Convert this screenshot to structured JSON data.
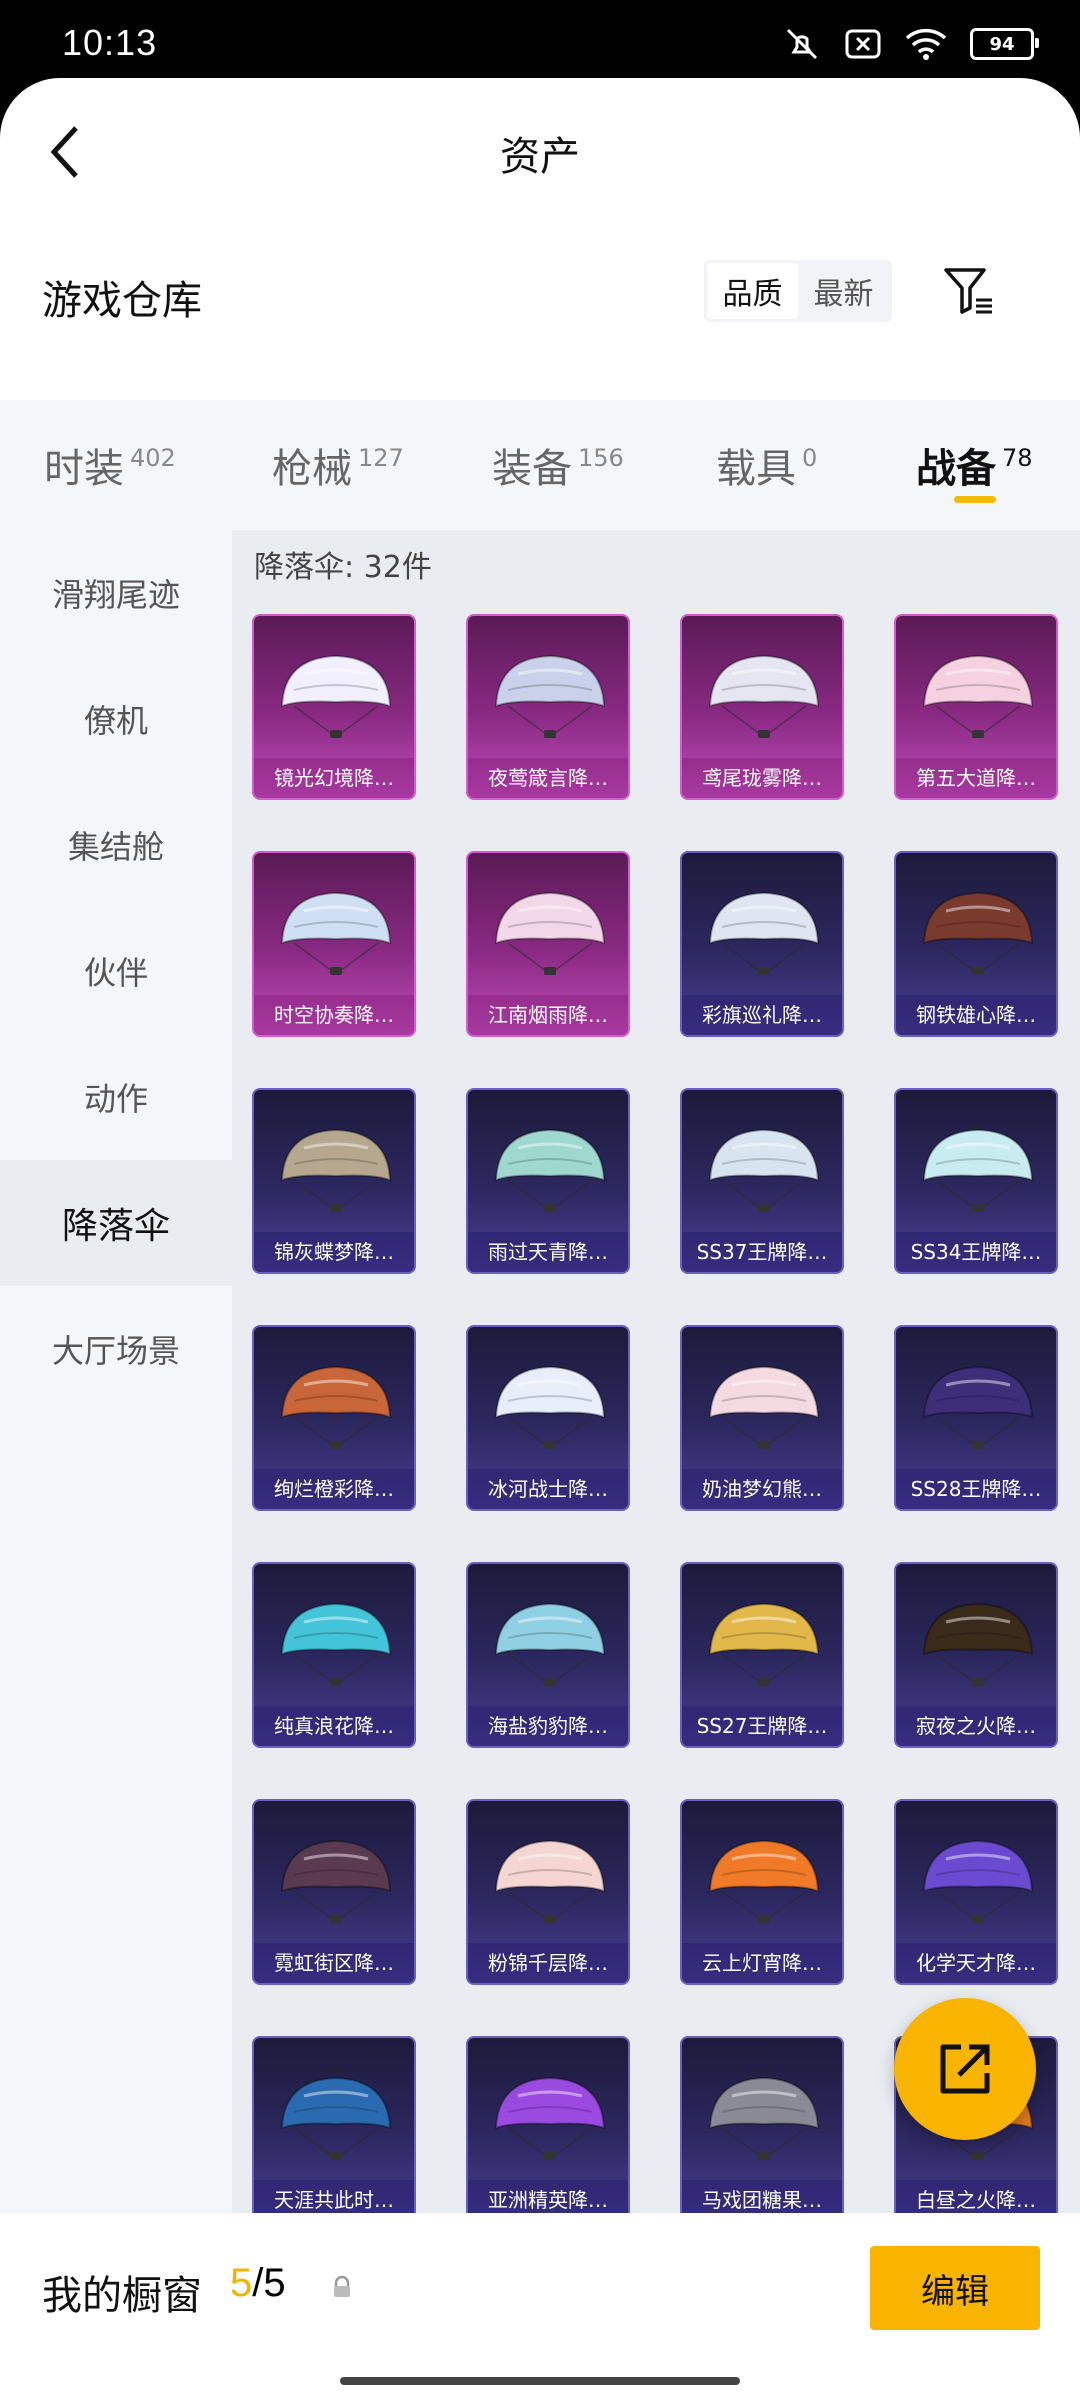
{
  "status_bar": {
    "time": "10:13",
    "battery": "94"
  },
  "nav": {
    "title": "资产"
  },
  "warehouse": {
    "title": "游戏仓库",
    "sort_options": [
      "品质",
      "最新"
    ],
    "active_sort": "品质"
  },
  "tabs": [
    {
      "label": "时装",
      "count": "402",
      "active": false
    },
    {
      "label": "枪械",
      "count": "127",
      "active": false
    },
    {
      "label": "装备",
      "count": "156",
      "active": false
    },
    {
      "label": "载具",
      "count": "0",
      "active": false
    },
    {
      "label": "战备",
      "count": "78",
      "active": true
    }
  ],
  "sidebar": {
    "items": [
      {
        "label": "滑翔尾迹",
        "active": false
      },
      {
        "label": "僚机",
        "active": false
      },
      {
        "label": "集结舱",
        "active": false
      },
      {
        "label": "伙伴",
        "active": false
      },
      {
        "label": "动作",
        "active": false
      },
      {
        "label": "降落伞",
        "active": true
      },
      {
        "label": "大厅场景",
        "active": false
      }
    ]
  },
  "content": {
    "count_label": "降落伞: 32件",
    "items": [
      {
        "name": "镜光幻境降…",
        "rarity": "purple",
        "color": "#f2f0ff"
      },
      {
        "name": "夜莺箴言降…",
        "rarity": "purple",
        "color": "#c9d2ea"
      },
      {
        "name": "鸢尾珑雾降…",
        "rarity": "purple",
        "color": "#e6e6f2"
      },
      {
        "name": "第五大道降…",
        "rarity": "purple",
        "color": "#f6d2e0"
      },
      {
        "name": "时空协奏降…",
        "rarity": "purple",
        "color": "#cfe0f4"
      },
      {
        "name": "江南烟雨降…",
        "rarity": "purple",
        "color": "#f2d8e8"
      },
      {
        "name": "彩旗巡礼降…",
        "rarity": "blue",
        "color": "#dfe6f2"
      },
      {
        "name": "钢铁雄心降…",
        "rarity": "blue",
        "color": "#7a3a2e"
      },
      {
        "name": "锦灰蝶梦降…",
        "rarity": "blue",
        "color": "#b5a88e"
      },
      {
        "name": "雨过天青降…",
        "rarity": "blue",
        "color": "#9fd8cf"
      },
      {
        "name": "SS37王牌降…",
        "rarity": "blue",
        "color": "#d8e4f0"
      },
      {
        "name": "SS34王牌降…",
        "rarity": "blue",
        "color": "#c8ecf0"
      },
      {
        "name": "绚烂橙彩降…",
        "rarity": "blue",
        "color": "#c8663a"
      },
      {
        "name": "冰河战士降…",
        "rarity": "blue",
        "color": "#e8eefa"
      },
      {
        "name": "奶油梦幻熊…",
        "rarity": "blue",
        "color": "#f4dbe2"
      },
      {
        "name": "SS28王牌降…",
        "rarity": "blue",
        "color": "#3d2e7a"
      },
      {
        "name": "纯真浪花降…",
        "rarity": "blue",
        "color": "#43c4d8"
      },
      {
        "name": "海盐豹豹降…",
        "rarity": "blue",
        "color": "#8fd0e4"
      },
      {
        "name": "SS27王牌降…",
        "rarity": "blue",
        "color": "#e2b84a"
      },
      {
        "name": "寂夜之火降…",
        "rarity": "blue",
        "color": "#3a2a1a"
      },
      {
        "name": "霓虹街区降…",
        "rarity": "blue",
        "color": "#5a3a50"
      },
      {
        "name": "粉锦千层降…",
        "rarity": "blue",
        "color": "#f6d6d2"
      },
      {
        "name": "云上灯宵降…",
        "rarity": "blue",
        "color": "#f07a28"
      },
      {
        "name": "化学天才降…",
        "rarity": "blue",
        "color": "#6a4ad0"
      },
      {
        "name": "天涯共此时…",
        "rarity": "blue",
        "color": "#2a6ab0"
      },
      {
        "name": "亚洲精英降…",
        "rarity": "blue",
        "color": "#9a4ae0"
      },
      {
        "name": "马戏团糖果…",
        "rarity": "blue",
        "color": "#8a8a96"
      },
      {
        "name": "白昼之火降…",
        "rarity": "blue",
        "color": "#e07a20"
      }
    ]
  },
  "showcase": {
    "label": "我的橱窗",
    "current": "5",
    "total": "/5",
    "edit_label": "编辑"
  },
  "colors": {
    "accent": "#f9b400",
    "purple_card": "#a03a9c",
    "blue_card": "#3a3380"
  }
}
